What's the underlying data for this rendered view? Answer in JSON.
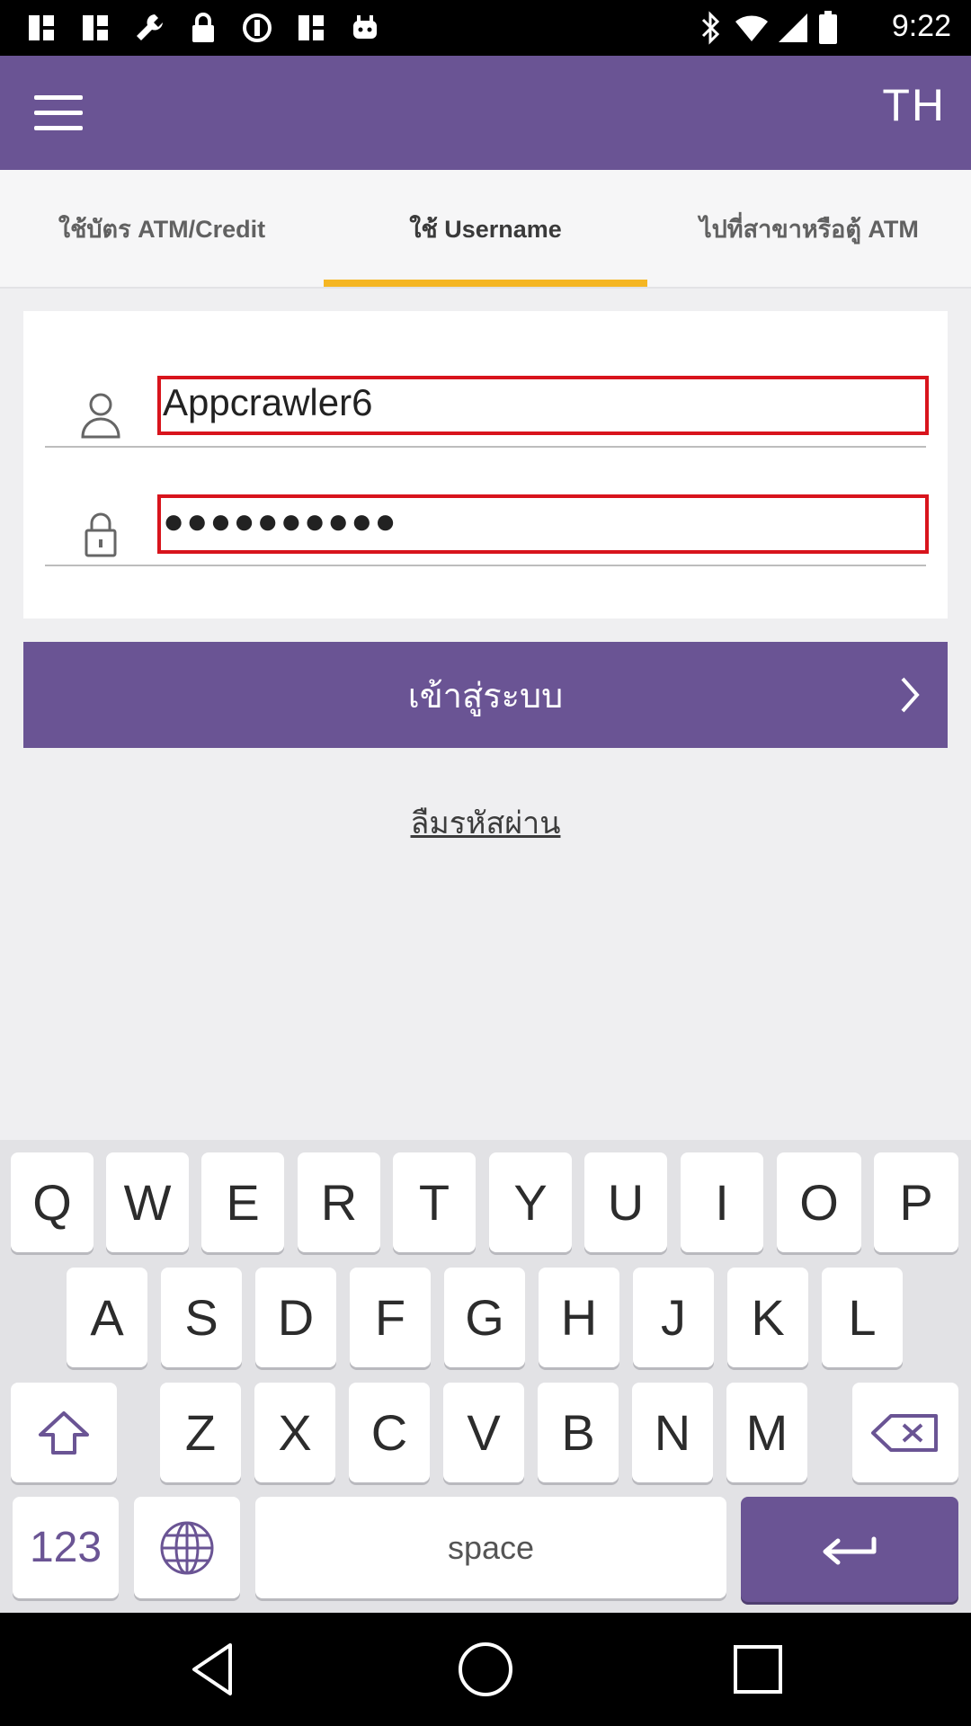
{
  "status_bar": {
    "time": "9:22",
    "left_icons": [
      "app-icon",
      "app-icon",
      "wrench-icon",
      "lock-icon",
      "sync-icon",
      "app-icon",
      "android-icon"
    ],
    "right_icons": [
      "bluetooth-icon",
      "wifi-icon",
      "signal-icon",
      "battery-icon"
    ]
  },
  "header": {
    "menu_icon": "hamburger-menu-icon",
    "language": "TH"
  },
  "tabs": [
    {
      "label": "ใช้บัตร ATM/Credit",
      "active": false
    },
    {
      "label": "ใช้ Username",
      "active": true
    },
    {
      "label": "ไปที่สาขาหรือตู้ ATM",
      "active": false
    }
  ],
  "form": {
    "username": {
      "icon": "user-icon",
      "value": "Appcrawler6"
    },
    "password": {
      "icon": "lock-icon",
      "value": "●●●●●●●●●●"
    }
  },
  "login_button": {
    "label": "เข้าสู่ระบบ",
    "icon": "chevron-right-icon"
  },
  "forgot_password": "ลืมรหัสผ่าน",
  "keyboard": {
    "row1": [
      "Q",
      "W",
      "E",
      "R",
      "T",
      "Y",
      "U",
      "I",
      "O",
      "P"
    ],
    "row2": [
      "A",
      "S",
      "D",
      "F",
      "G",
      "H",
      "J",
      "K",
      "L"
    ],
    "row3": [
      "Z",
      "X",
      "C",
      "V",
      "B",
      "N",
      "M"
    ],
    "shift_icon": "shift-arrow-icon",
    "backspace_icon": "backspace-icon",
    "numbers_label": "123",
    "globe_icon": "globe-icon",
    "space_label": "space",
    "enter_icon": "enter-arrow-icon"
  },
  "nav_bar": {
    "icons": [
      "back-icon",
      "home-icon",
      "recents-icon"
    ]
  },
  "colors": {
    "primary": "#6a5494",
    "accent": "#f5b623",
    "error_border": "#d8141c"
  }
}
